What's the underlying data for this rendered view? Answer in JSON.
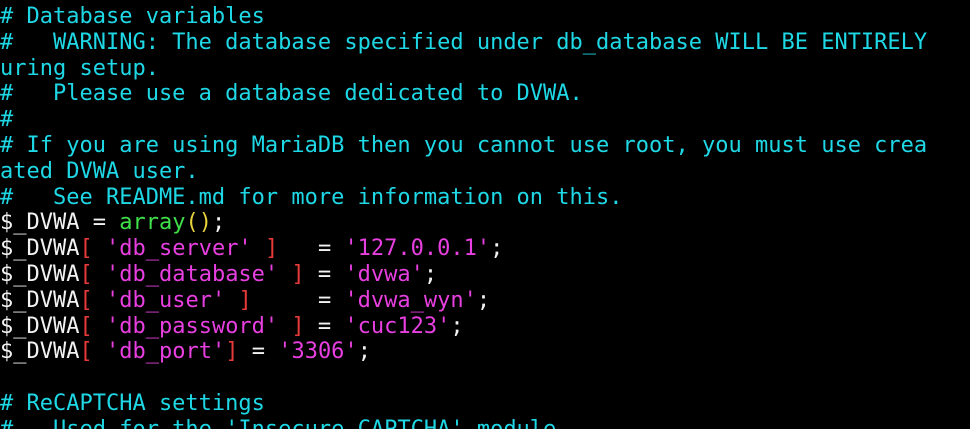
{
  "colors": {
    "background": "#000000",
    "comment": "#1fd8e6",
    "variable": "#f2f2f2",
    "function": "#3fe04a",
    "paren": "#e8d23c",
    "bracket": "#e93a3a",
    "string": "#e83fe0"
  },
  "lines": {
    "l1": "# Database variables",
    "l2": "#   WARNING: The database specified under db_database WILL BE ENTIRELY",
    "l3": "uring setup.",
    "l4": "#   Please use a database dedicated to DVWA.",
    "l5": "#",
    "l6": "# If you are using MariaDB then you cannot use root, you must use crea",
    "l7": "ated DVWA user.",
    "l8": "#   See README.md for more information on this.",
    "l15": "# ReCAPTCHA settings",
    "l16": "#   Used for the 'Insecure CAPTCHA' module"
  },
  "code": {
    "var": "$_DVWA",
    "eq": " = ",
    "array_fn": "array",
    "open_paren": "(",
    "close_paren": ")",
    "semi": ";",
    "open_br": "[",
    "close_br": "]",
    "rows": [
      {
        "key": "'db_server'",
        "pad_before_close": " ",
        "pad_after_close": "   ",
        "value": "'127.0.0.1'"
      },
      {
        "key": "'db_database'",
        "pad_before_close": " ",
        "pad_after_close": " ",
        "value": "'dvwa'"
      },
      {
        "key": "'db_user'",
        "pad_before_close": " ",
        "pad_after_close": "     ",
        "value": "'dvwa_wyn'"
      },
      {
        "key": "'db_password'",
        "pad_before_close": " ",
        "pad_after_close": " ",
        "value": "'cuc123'"
      },
      {
        "key": "'db_port'",
        "pad_before_close": "",
        "pad_after_close": " ",
        "value": "'3306'"
      }
    ]
  }
}
